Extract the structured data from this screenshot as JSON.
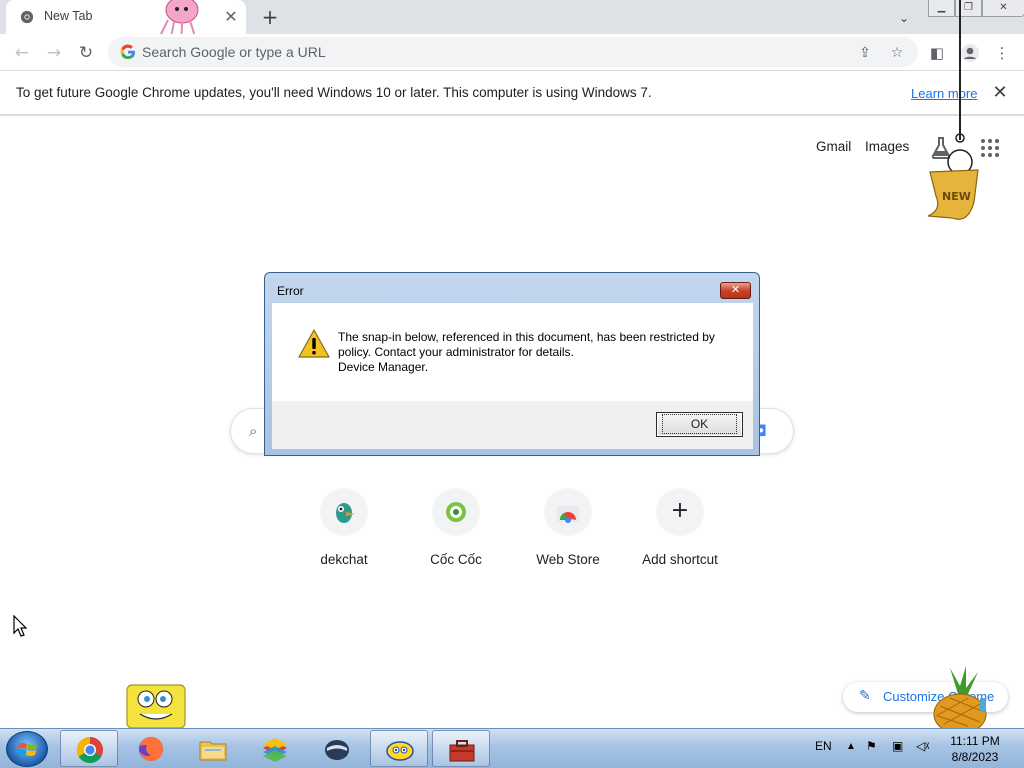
{
  "browser": {
    "tab_title": "New Tab",
    "omnibox_placeholder": "Search Google or type a URL"
  },
  "infobar": {
    "message": "To get future Google Chrome updates, you'll need Windows 10 or later. This computer is using Windows 7.",
    "link": "Learn more"
  },
  "ntp": {
    "top_links": [
      "Gmail",
      "Images"
    ],
    "shortcuts": [
      {
        "label": "dekchat",
        "icon": "dekchat-icon"
      },
      {
        "label": "Cốc Cốc",
        "icon": "coccoc-icon"
      },
      {
        "label": "Web Store",
        "icon": "webstore-icon"
      },
      {
        "label": "Add shortcut",
        "icon": "plus-icon"
      }
    ],
    "customize_label": "Customize Chrome"
  },
  "dialog": {
    "title": "Error",
    "message_line1": "The snap-in below, referenced in this document, has been restricted by",
    "message_line2": "policy. Contact your administrator for details.",
    "message_line3": "Device Manager.",
    "ok_label": "OK"
  },
  "taskbar": {
    "language": "EN",
    "time": "11:11 PM",
    "date": "8/8/2023",
    "apps": [
      "chrome-icon",
      "firefox-icon",
      "file-explorer-icon",
      "bluestacks-icon",
      "vpn-helmet-icon",
      "yahoo-messenger-icon",
      "toolbox-icon"
    ]
  },
  "decorations": {
    "badge_text": "NEW"
  },
  "colors": {
    "accent": "#1a73e8",
    "taskbar": "#a6c3e4",
    "dialog_close": "#c7452b"
  }
}
